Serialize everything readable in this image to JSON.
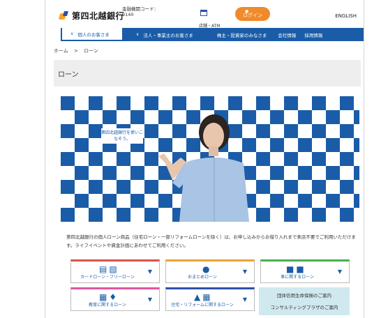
{
  "header": {
    "logo_text": "第四北越銀行",
    "bank_code": "金融機関コード：0140",
    "branch_atm": "店舗・ATM",
    "login": "ログイン",
    "english": "ENGLISH"
  },
  "nav": {
    "items": [
      {
        "label": "個人のお客さま",
        "active": true
      },
      {
        "label": "法人・事業主のお客さま",
        "active": false
      },
      {
        "label": "株主・投資家のみなさま",
        "active": false
      },
      {
        "label": "会社情報",
        "active": false
      },
      {
        "label": "採用情報",
        "active": false
      }
    ]
  },
  "breadcrumb": {
    "home": "ホーム",
    "separator": ">",
    "current": "ローン"
  },
  "page_title": "ローン",
  "hero": {
    "tagline": "第四北越銀行を使いこなそう。"
  },
  "description": "第四北越銀行の個人ローン商品（住宅ローン・一部リフォームローンを除く）は、お申し込みからお借り入れまで来店不要でご利用いただけます。ライフイベントや資金計画にあわせてご利用ください。",
  "cards": [
    {
      "label": "カードローン・フリーローン",
      "accent": "#d9534f"
    },
    {
      "label": "おまとめローン",
      "accent": "#e8a33a"
    },
    {
      "label": "車に関するローン",
      "accent": "#4caf50"
    },
    {
      "label": "教育に関するローン",
      "accent": "#e056a0"
    },
    {
      "label": "住宅・リフォームに関するローン",
      "accent": "#2c4fa8"
    }
  ],
  "promo": {
    "line1": "団体信用生命保険のご案内",
    "line2": "コンサルティングプラザのご案内"
  },
  "colors": {
    "brand_blue": "#1a5ca8",
    "login_orange": "#f08a2a"
  }
}
